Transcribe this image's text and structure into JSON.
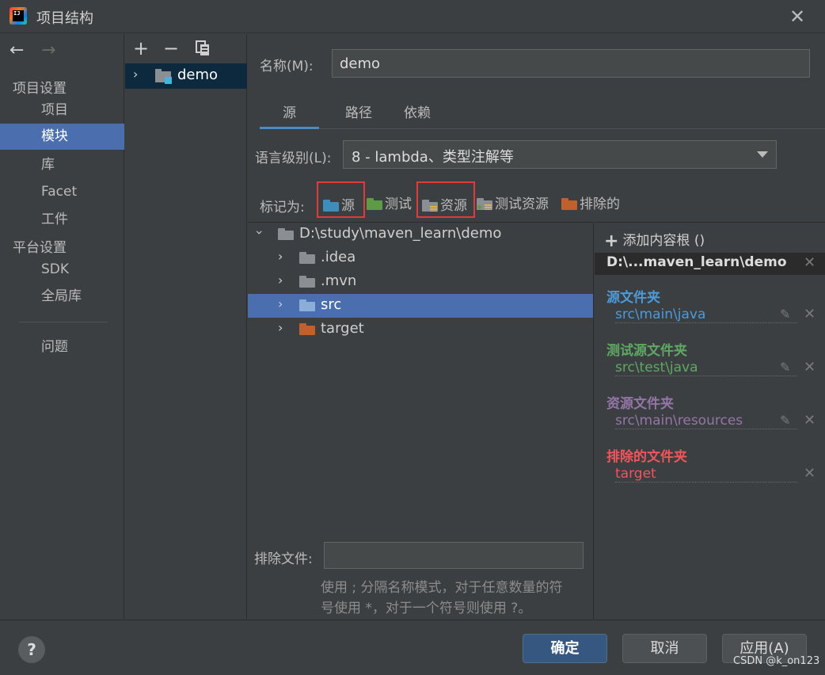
{
  "window": {
    "title": "项目结构",
    "logo_text": "IJ",
    "close_icon": "close-icon"
  },
  "nav": {
    "back_glyph": "←",
    "forward_glyph": "→",
    "section_project": "项目设置",
    "items_project": [
      "项目",
      "模块",
      "库",
      "Facet",
      "工件"
    ],
    "section_platform": "平台设置",
    "items_platform": [
      "SDK",
      "全局库"
    ],
    "problems": "问题",
    "selected": "模块"
  },
  "modules": {
    "toolbar": {
      "add": "+",
      "remove": "−",
      "copy_icon": "copy-icon"
    },
    "items": [
      {
        "name": "demo"
      }
    ]
  },
  "module": {
    "name_label": "名称(M):",
    "name_value": "demo",
    "tabs": [
      "源",
      "路径",
      "依赖"
    ],
    "active_tab": "源",
    "lang_label": "语言级别(L):",
    "lang_value": "8 - lambda、类型注解等",
    "mark_label": "标记为:",
    "mark_as": [
      {
        "label": "源",
        "color": "#3d8dbd",
        "highlighted": true
      },
      {
        "label": "测试",
        "color": "#5d9b47",
        "highlighted": false
      },
      {
        "label": "资源",
        "color": "#8a8f94",
        "highlighted": true
      },
      {
        "label": "测试资源",
        "color": "#8a8f94",
        "highlighted": false
      },
      {
        "label": "排除的",
        "color": "#c0602c",
        "highlighted": false
      }
    ]
  },
  "tree": {
    "root": "D:\\study\\maven_learn\\demo",
    "children": [
      {
        "name": ".idea",
        "color": "#8a8f94",
        "selected": false
      },
      {
        "name": ".mvn",
        "color": "#8a8f94",
        "selected": false
      },
      {
        "name": "src",
        "color": "#8aaed8",
        "selected": true
      },
      {
        "name": "target",
        "color": "#c0602c",
        "selected": false
      }
    ]
  },
  "exclude": {
    "label": "排除文件:",
    "value": "",
    "hint_line1": "使用 ; 分隔名称模式，对于任意数量的符",
    "hint_line2": "号使用 *，对于一个符号则使用 ?。"
  },
  "roots": {
    "add_label": "添加内容根 ()",
    "root_path": "D:\\...maven_learn\\demo",
    "groups": [
      {
        "title": "源文件夹",
        "path": "src\\main\\java",
        "color": "#4a9bdc",
        "editable": true
      },
      {
        "title": "测试源文件夹",
        "path": "src\\test\\java",
        "color": "#5fa863",
        "editable": true
      },
      {
        "title": "资源文件夹",
        "path": "src\\main\\resources",
        "color": "#9475a8",
        "editable": true
      },
      {
        "title": "排除的文件夹",
        "path": "target",
        "color": "#f0555b",
        "editable": false
      }
    ]
  },
  "footer": {
    "help": "?",
    "ok": "确定",
    "cancel": "取消",
    "apply": "应用(A)",
    "watermark": "CSDN @k_on123"
  }
}
